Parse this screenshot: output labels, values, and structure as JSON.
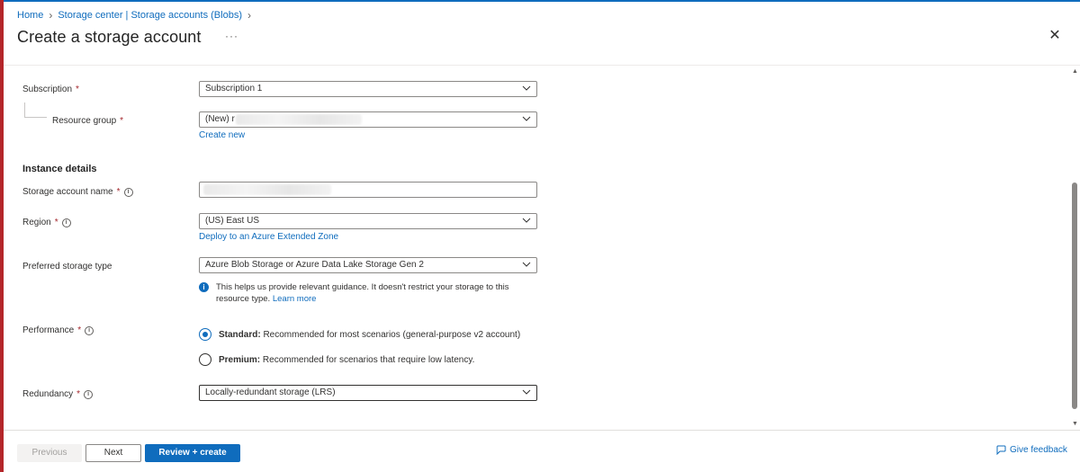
{
  "breadcrumb": {
    "home": "Home",
    "storage_center": "Storage center | Storage accounts (Blobs)"
  },
  "header": {
    "title": "Create a storage account",
    "more": "···",
    "close": "✕"
  },
  "form": {
    "subscription": {
      "label": "Subscription",
      "required": "*",
      "value": "Subscription 1"
    },
    "resource_group": {
      "label": "Resource group",
      "required": "*",
      "value": "(New) r",
      "create_new": "Create new"
    },
    "instance_details": {
      "title": "Instance details"
    },
    "storage_account_name": {
      "label": "Storage account name",
      "required": "*"
    },
    "region": {
      "label": "Region",
      "required": "*",
      "value": "(US) East US",
      "link": "Deploy to an Azure Extended Zone"
    },
    "preferred_storage_type": {
      "label": "Preferred storage type",
      "value": "Azure Blob Storage or Azure Data Lake Storage Gen 2",
      "info": "This helps us provide relevant guidance. It doesn't restrict your storage to this resource type.",
      "learn_more": "Learn more"
    },
    "performance": {
      "label": "Performance",
      "required": "*",
      "options": [
        {
          "name": "Standard:",
          "desc": "Recommended for most scenarios (general-purpose v2 account)",
          "selected": true
        },
        {
          "name": "Premium:",
          "desc": "Recommended for scenarios that require low latency.",
          "selected": false
        }
      ]
    },
    "redundancy": {
      "label": "Redundancy",
      "required": "*",
      "value": "Locally-redundant storage (LRS)"
    }
  },
  "footer": {
    "previous": "Previous",
    "next": "Next",
    "review_create": "Review + create",
    "feedback": "Give feedback"
  },
  "colors": {
    "accent": "#0f6cbd",
    "required": "#a4262c",
    "left_border": "#b4262a"
  },
  "icons": [
    "chevron-right-icon",
    "more-icon",
    "close-icon",
    "chevron-down-icon",
    "info-icon",
    "feedback-icon"
  ]
}
